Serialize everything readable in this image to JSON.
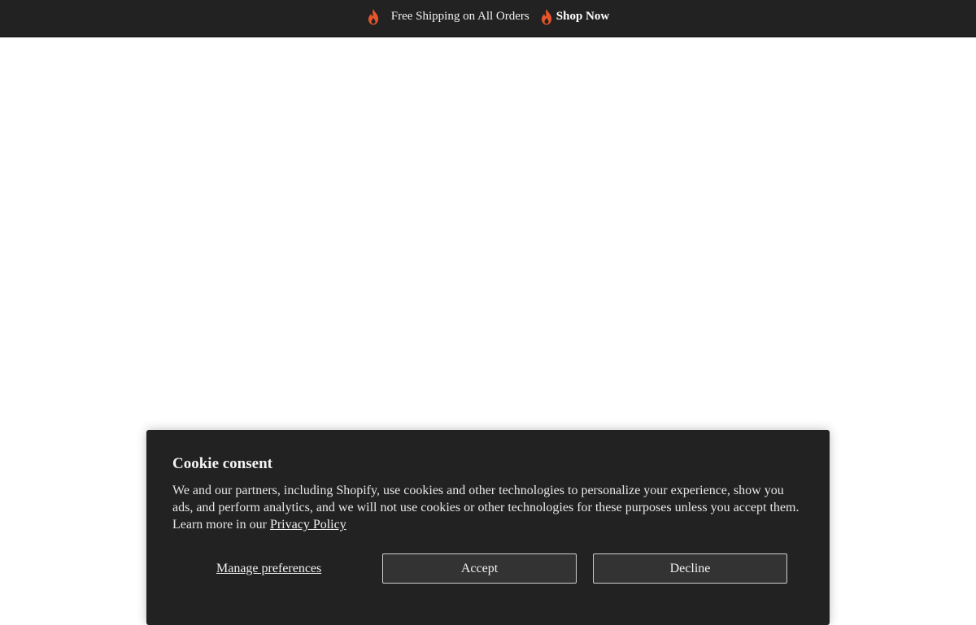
{
  "announcement": {
    "text": "Free Shipping on All Orders",
    "link_label": "Shop Now",
    "icon": "flame-icon",
    "icon_color": "#e8552a",
    "background": "#222222"
  },
  "cookie_banner": {
    "title": "Cookie consent",
    "body": "We and our partners, including Shopify, use cookies and other technologies to personalize your experience, show you ads, and perform analytics, and we will not use cookies or other technologies for these purposes unless you accept them. Learn more in our ",
    "privacy_link_label": "Privacy Policy",
    "manage_label": "Manage preferences",
    "accept_label": "Accept",
    "decline_label": "Decline",
    "background": "#222222"
  }
}
